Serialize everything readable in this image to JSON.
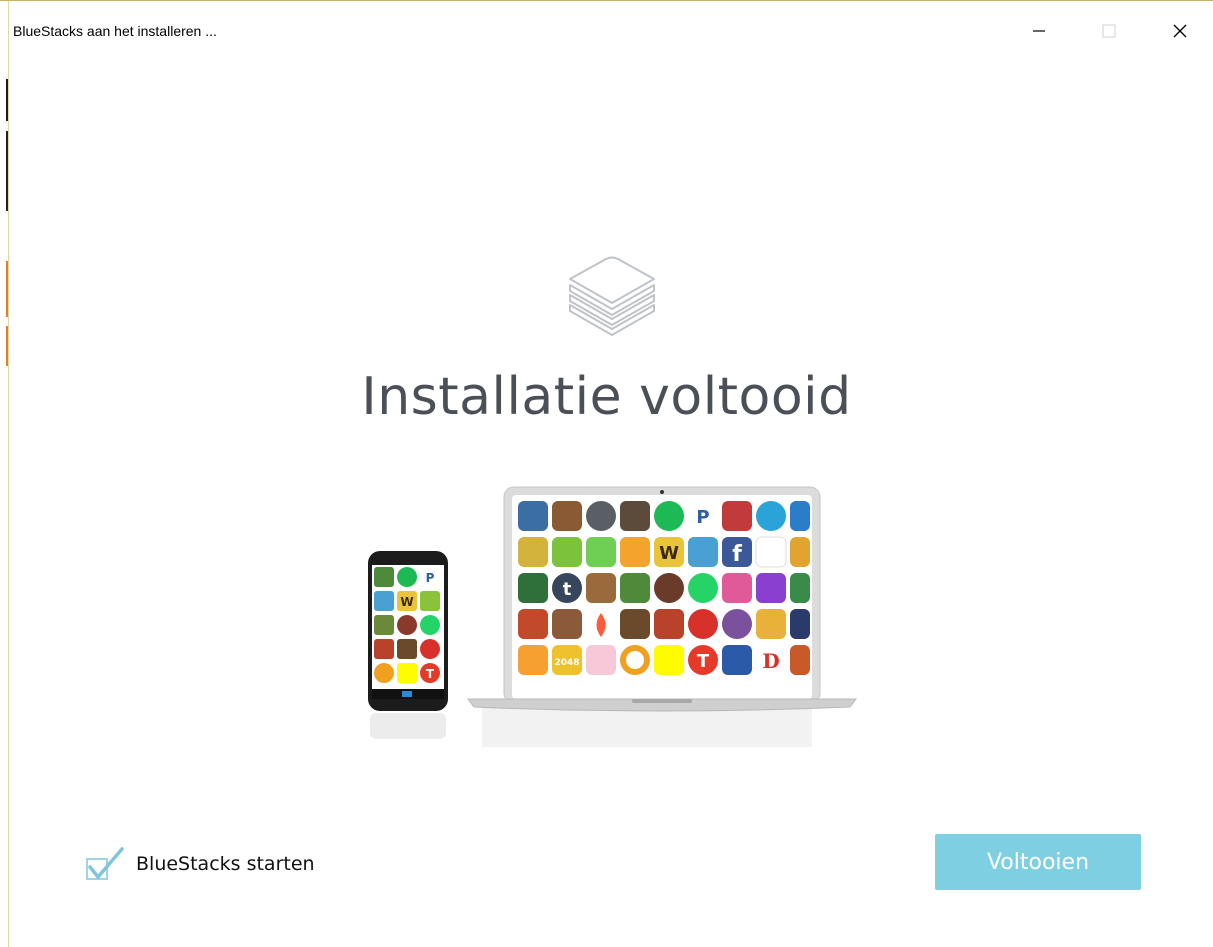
{
  "window": {
    "title": "BlueStacks aan het installeren ..."
  },
  "controls": {
    "minimize_icon": "minimize-icon",
    "maximize_icon": "maximize-icon",
    "close_icon": "close-icon"
  },
  "main": {
    "logo_icon": "stacked-layers-icon",
    "headline": "Installatie voltooid",
    "illustration_icon": "phone-and-laptop-app-grid-illustration"
  },
  "footer": {
    "launch_checkbox_label": "BlueStacks starten",
    "launch_checkbox_checked": true,
    "finish_button_label": "Voltooien"
  },
  "colors": {
    "accent": "#7fcfe3",
    "headline": "#4b4f58",
    "checkmark": "#7fc6dd"
  }
}
